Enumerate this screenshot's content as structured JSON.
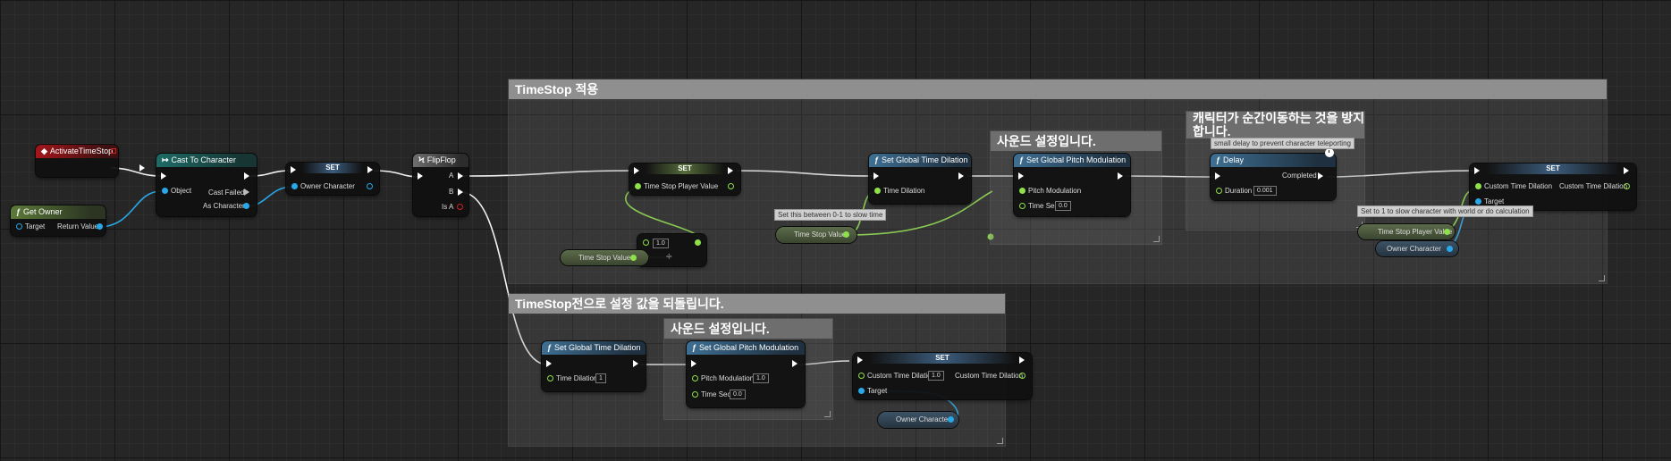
{
  "comments": {
    "main": "TimeStop 적용",
    "revert": "TimeStop전으로 설정 값을 되돌립니다.",
    "sound1": "사운드 설정입니다.",
    "sound2": "사운드 설정입니다.",
    "teleport": "캐릭터가 순간이동하는 것을 방지합니다."
  },
  "nodes": {
    "activate_event": {
      "title": "ActivateTimeStop"
    },
    "get_owner": {
      "title": "Get Owner",
      "target": "Target",
      "return_value": "Return Value"
    },
    "cast": {
      "title": "Cast To Character",
      "object": "Object",
      "cast_failed": "Cast Failed",
      "as_character": "As Character"
    },
    "set_owner": {
      "title": "SET",
      "owner_character": "Owner Character"
    },
    "flipflop": {
      "title": "FlipFlop",
      "a": "A",
      "b": "B",
      "is_a": "Is A"
    },
    "set_player_value": {
      "title": "SET",
      "pin": "Time Stop Player Value"
    },
    "divide": {
      "value": "1.0",
      "symbol": "÷"
    },
    "timestop_value_a": {
      "label": "Time Stop Value"
    },
    "global_dilation_a": {
      "title": "Set Global Time Dilation",
      "pin": "Time Dilation"
    },
    "timestop_value_b": {
      "label": "Time Stop Value"
    },
    "pitch_a": {
      "title": "Set Global Pitch Modulation",
      "pitch": "Pitch Modulation",
      "time_sec": "Time Sec",
      "time_sec_value": "0.0"
    },
    "delay": {
      "title": "Delay",
      "completed": "Completed",
      "duration": "Duration",
      "duration_value": "0.001"
    },
    "set_custom_a": {
      "title": "SET",
      "custom": "Custom Time Dilation",
      "custom_out": "Custom Time Dilation",
      "target": "Target"
    },
    "player_value_get": {
      "label": "Time Stop Player Value"
    },
    "owner_get_a": {
      "label": "Owner Character"
    },
    "global_dilation_b": {
      "title": "Set Global Time Dilation",
      "pin": "Time Dilation",
      "value": "1"
    },
    "pitch_b": {
      "title": "Set Global Pitch Modulation",
      "pitch": "Pitch Modulation",
      "pitch_value": "1.0",
      "time_sec": "Time Sec",
      "time_sec_value": "0.0"
    },
    "set_custom_b": {
      "title": "SET",
      "custom": "Custom Time Dilation",
      "custom_value": "1.0",
      "custom_out": "Custom Time Dilation",
      "target": "Target"
    },
    "owner_get_b": {
      "label": "Owner Character"
    }
  },
  "tooltips": {
    "slow_time": "Set this between 0-1 to slow time",
    "delay_note": "small delay to prevent character teleporting",
    "character_note": "Set to 1 to slow character with world or do calculation"
  },
  "colors": {
    "exec": "#ffffff",
    "float": "#8fe04a",
    "object": "#28a8e8",
    "bool": "#d02020",
    "comment": "#8f8f8f"
  }
}
